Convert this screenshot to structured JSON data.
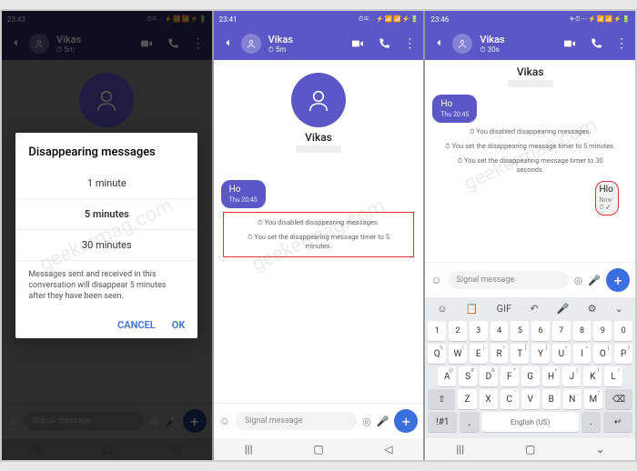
{
  "colors": {
    "accent": "#5b57c7",
    "send": "#3b6fe0",
    "highlight": "#d33"
  },
  "watermark": "geekermag.com",
  "s1": {
    "time": "23:43",
    "contact": "Vikas",
    "timer": "5m",
    "dialog": {
      "title": "Disappearing messages",
      "opts": [
        "1 minute",
        "5 minutes",
        "30 minutes"
      ],
      "selected": 1,
      "note": "Messages sent and received in this conversation will disappear 5 minutes after they have been seen.",
      "cancel": "CANCEL",
      "ok": "OK"
    },
    "placeholder": "Signal message"
  },
  "s2": {
    "time": "23:41",
    "contact": "Vikas",
    "timer": "5m",
    "bigname": "Vikas",
    "msg": {
      "text": "Ho",
      "time": "Thu 20:45"
    },
    "sys": [
      "You disabled disappearing messages.",
      "You set the disappearing message timer to 5 minutes."
    ],
    "placeholder": "Signal message"
  },
  "s3": {
    "time": "23:46",
    "contact": "Vikas",
    "timer": "30s",
    "bigname": "Vikas",
    "msg": {
      "text": "Ho",
      "time": "Thu 20:45"
    },
    "sys": [
      "You disabled disappearing messages.",
      "You set the disappearing message timer to 5 minutes.",
      "You set the disappearing message timer to 30 seconds."
    ],
    "msgin": {
      "text": "Hlo",
      "time": "Now"
    },
    "placeholder": "Signal message",
    "kbd": {
      "tool": [
        "☺",
        "📋",
        "GIF",
        "↶",
        "🎤",
        "⚙",
        "⌄"
      ],
      "r1": [
        "1",
        "2",
        "3",
        "4",
        "5",
        "6",
        "7",
        "8",
        "9",
        "0"
      ],
      "r2": [
        [
          "Q",
          "%"
        ],
        [
          "W",
          "\\"
        ],
        [
          "E",
          "|"
        ],
        [
          "R",
          "="
        ],
        [
          "T",
          "["
        ],
        [
          "Y",
          "]"
        ],
        [
          "U",
          "<"
        ],
        [
          "I",
          ">"
        ],
        [
          "O",
          "{"
        ],
        [
          "P",
          "}"
        ]
      ],
      "r3": [
        [
          "A",
          "@"
        ],
        [
          "S",
          "#"
        ],
        [
          "D",
          "&"
        ],
        [
          "F",
          "*"
        ],
        [
          "G",
          "-"
        ],
        [
          "H",
          "+"
        ],
        [
          "J",
          "("
        ],
        [
          "K",
          ")"
        ],
        [
          "L",
          "/"
        ]
      ],
      "r4_shift": "⇧",
      "r4": [
        [
          "Z",
          ""
        ],
        [
          "X",
          "'"
        ],
        [
          "C",
          "\""
        ],
        [
          "V",
          ":"
        ],
        [
          "B",
          ";"
        ],
        [
          "N",
          ","
        ],
        [
          "M",
          "?"
        ]
      ],
      "r4_bksp": "⌫",
      "r5": {
        "sym": "!#1",
        "lang": ",",
        "space": "English (US)",
        "dot": ".",
        "enter": "↵"
      }
    }
  }
}
